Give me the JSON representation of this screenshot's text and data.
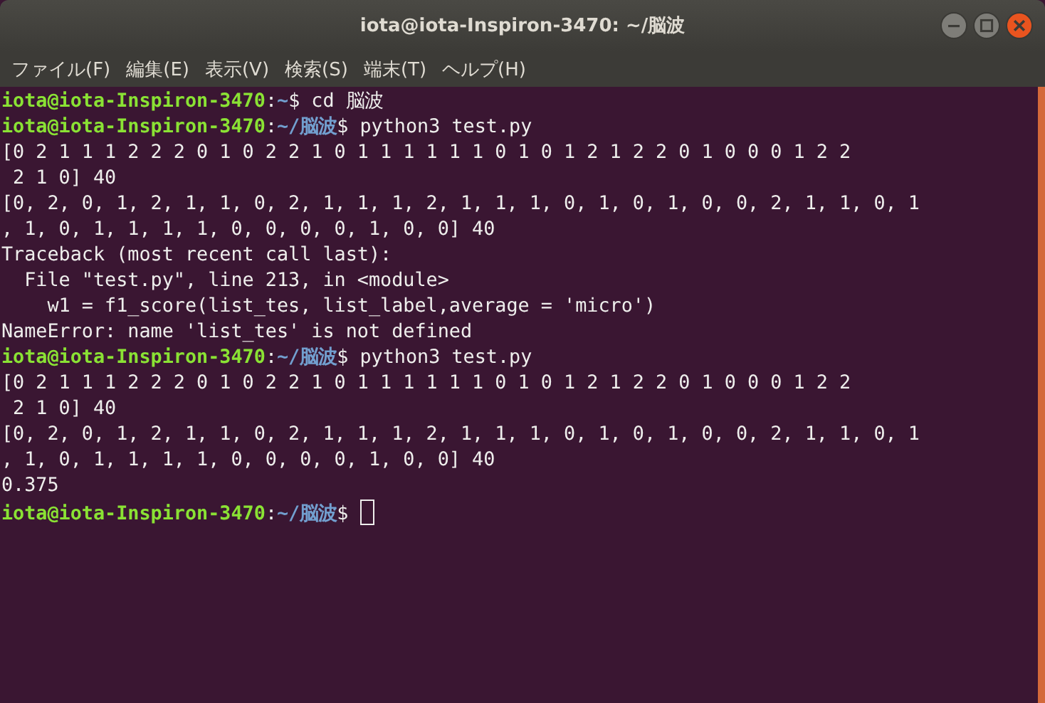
{
  "window": {
    "title": "iota@iota-Inspiron-3470: ~/脳波",
    "controls": [
      {
        "kind": "minimize"
      },
      {
        "kind": "maximize"
      },
      {
        "kind": "close"
      }
    ]
  },
  "menu": [
    "ファイル(F)",
    "編集(E)",
    "表示(V)",
    "検索(S)",
    "端末(T)",
    "ヘルプ(H)"
  ],
  "terminal": {
    "lines": [
      {
        "kind": "prompt",
        "user": "iota@iota-Inspiron-3470",
        "colon": ":",
        "path": "~",
        "dollar": "$",
        "command": " cd 脳波"
      },
      {
        "kind": "prompt",
        "user": "iota@iota-Inspiron-3470",
        "colon": ":",
        "path": "~/脳波",
        "dollar": "$",
        "command": " python3 test.py"
      },
      {
        "kind": "output",
        "text": "[0 2 1 1 1 2 2 2 0 1 0 2 2 1 0 1 1 1 1 1 1 0 1 0 1 2 1 2 2 0 1 0 0 0 1 2 2"
      },
      {
        "kind": "output",
        "text": " 2 1 0] 40"
      },
      {
        "kind": "output",
        "text": "[0, 2, 0, 1, 2, 1, 1, 0, 2, 1, 1, 1, 2, 1, 1, 1, 0, 1, 0, 1, 0, 0, 2, 1, 1, 0, 1"
      },
      {
        "kind": "output",
        "text": ", 1, 0, 1, 1, 1, 1, 0, 0, 0, 0, 1, 0, 0] 40"
      },
      {
        "kind": "output",
        "text": "Traceback (most recent call last):"
      },
      {
        "kind": "output",
        "text": "  File \"test.py\", line 213, in <module>"
      },
      {
        "kind": "output",
        "text": "    w1 = f1_score(list_tes, list_label,average = 'micro')"
      },
      {
        "kind": "output",
        "text": "NameError: name 'list_tes' is not defined"
      },
      {
        "kind": "prompt",
        "user": "iota@iota-Inspiron-3470",
        "colon": ":",
        "path": "~/脳波",
        "dollar": "$",
        "command": " python3 test.py"
      },
      {
        "kind": "output",
        "text": "[0 2 1 1 1 2 2 2 0 1 0 2 2 1 0 1 1 1 1 1 1 0 1 0 1 2 1 2 2 0 1 0 0 0 1 2 2"
      },
      {
        "kind": "output",
        "text": " 2 1 0] 40"
      },
      {
        "kind": "output",
        "text": "[0, 2, 0, 1, 2, 1, 1, 0, 2, 1, 1, 1, 2, 1, 1, 1, 0, 1, 0, 1, 0, 0, 2, 1, 1, 0, 1"
      },
      {
        "kind": "output",
        "text": ", 1, 0, 1, 1, 1, 1, 0, 0, 0, 0, 1, 0, 0] 40"
      },
      {
        "kind": "output",
        "text": "0.375"
      },
      {
        "kind": "prompt",
        "user": "iota@iota-Inspiron-3470",
        "colon": ":",
        "path": "~/脳波",
        "dollar": "$",
        "cursor": true
      }
    ]
  }
}
